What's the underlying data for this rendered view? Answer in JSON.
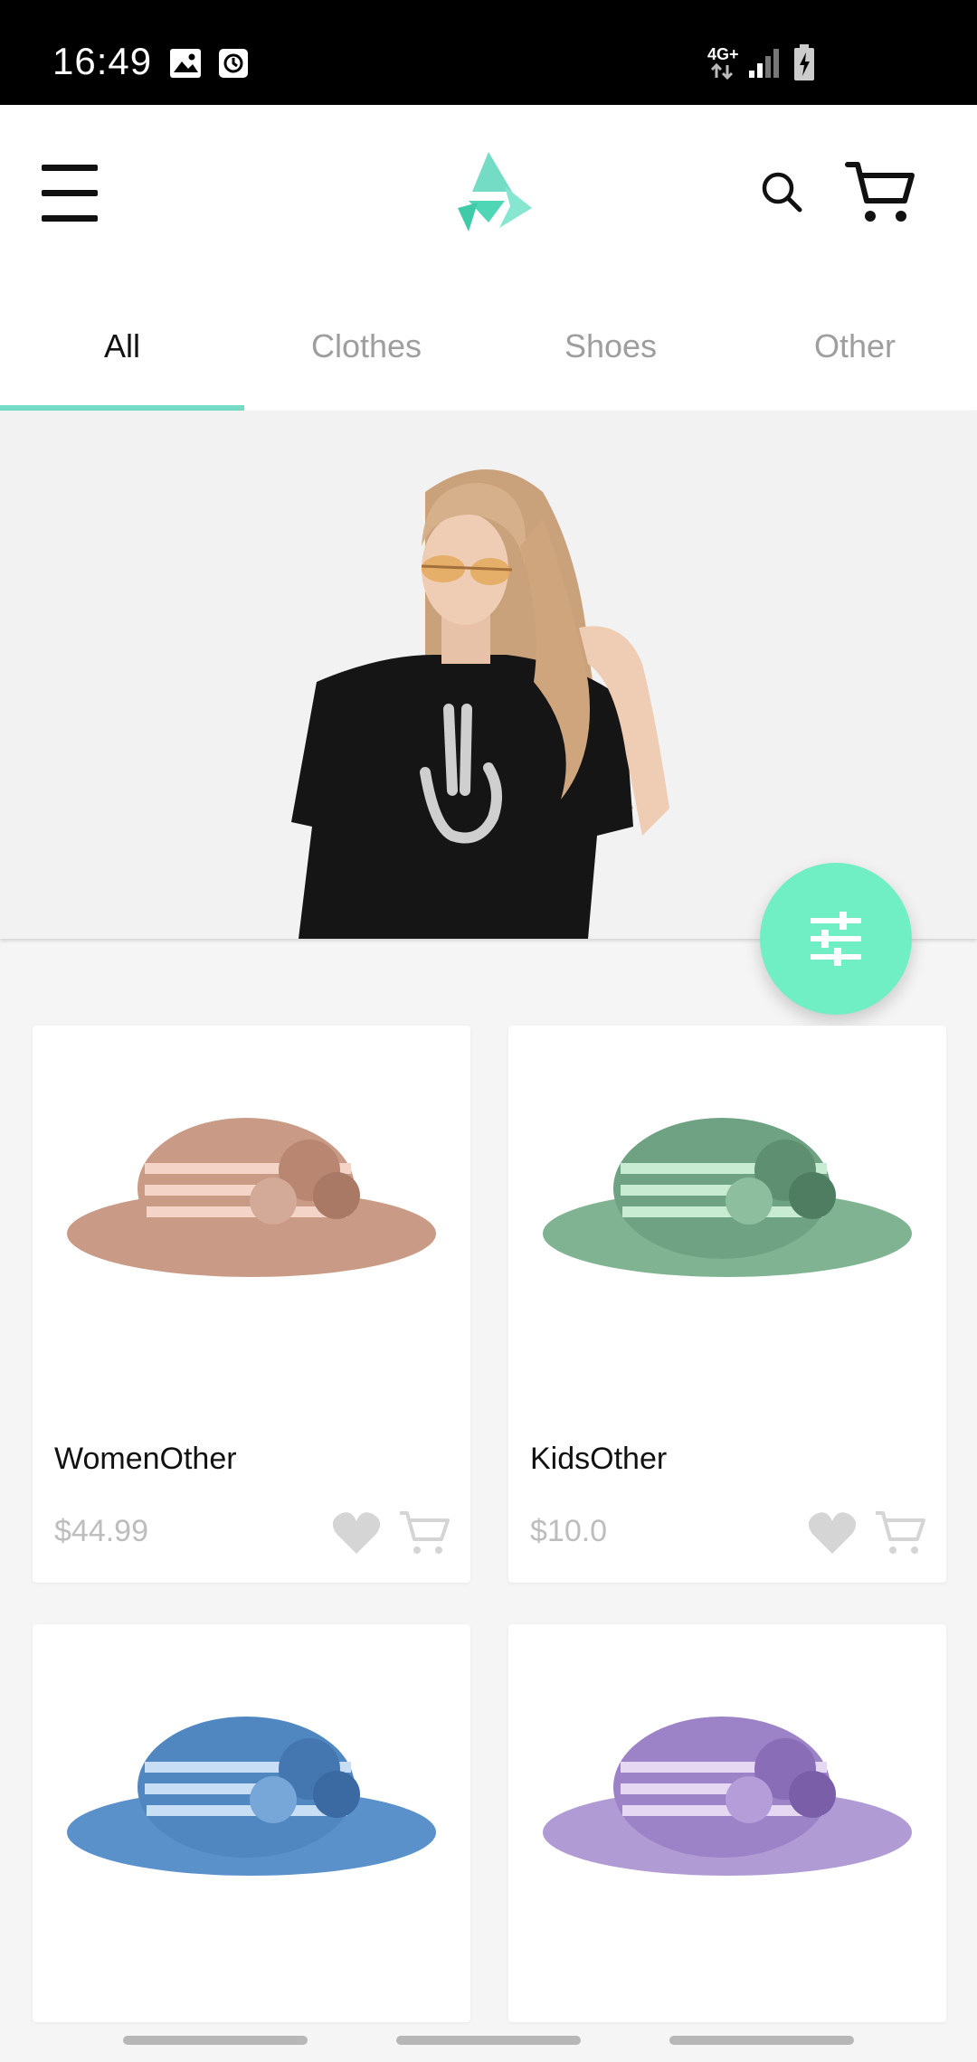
{
  "status": {
    "time": "16:49",
    "network": "4G+",
    "icons": [
      "image-icon",
      "clock-icon",
      "signal-icon",
      "battery-charging-icon"
    ]
  },
  "header": {
    "menu_icon": "hamburger-menu-icon",
    "logo_icon": "brand-logo-icon",
    "search_icon": "search-icon",
    "cart_icon": "cart-icon"
  },
  "tabs": [
    {
      "label": "All",
      "active": true
    },
    {
      "label": "Clothes",
      "active": false
    },
    {
      "label": "Shoes",
      "active": false
    },
    {
      "label": "Other",
      "active": false
    }
  ],
  "fab": {
    "icon": "filter-sliders-icon"
  },
  "products": [
    {
      "name": "WomenOther",
      "price": "$44.99",
      "color": "#c99b86"
    },
    {
      "name": "KidsOther",
      "price": "$10.0",
      "color": "#7fb392"
    },
    {
      "name": "",
      "price": "",
      "color": "#5a91cb"
    },
    {
      "name": "",
      "price": "",
      "color": "#9c82c6"
    }
  ],
  "colors": {
    "accent": "#74dcc4",
    "fab": "#70efc4",
    "muted": "#bdbdbd"
  }
}
